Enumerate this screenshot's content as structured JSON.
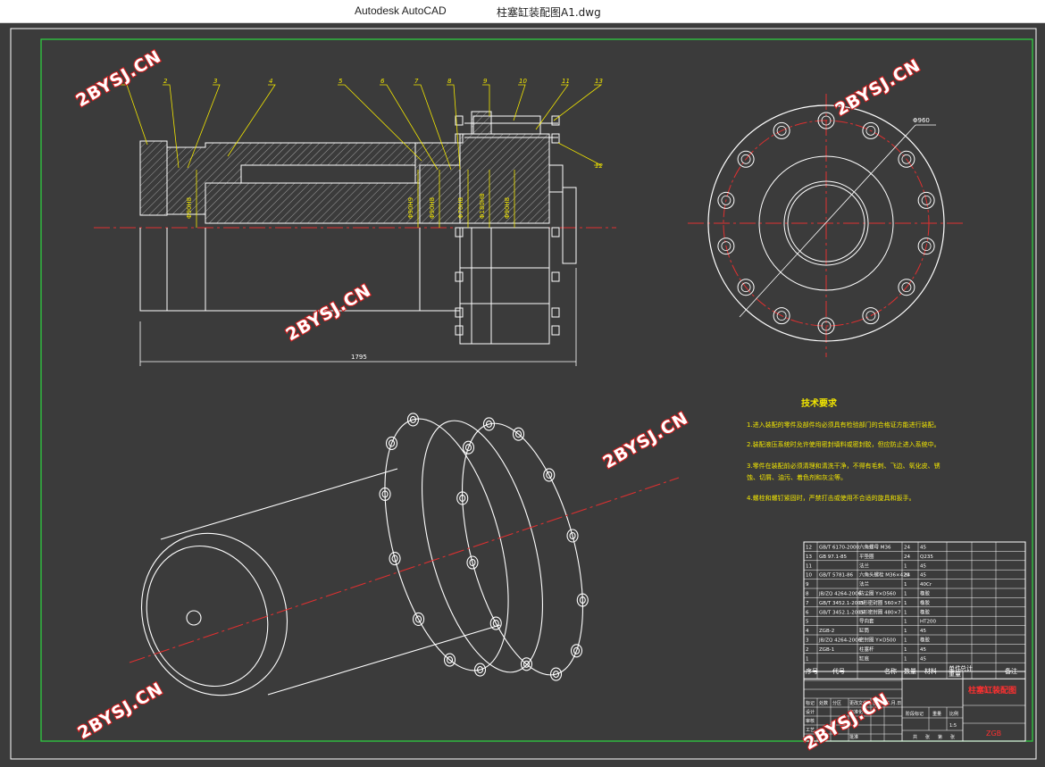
{
  "window": {
    "app_name": "Autodesk AutoCAD",
    "file_name": "柱塞缸装配图A1.dwg"
  },
  "drawing": {
    "watermark": "2BYSJ.CN",
    "part_numbers": [
      "1",
      "2",
      "3",
      "4",
      "5",
      "6",
      "7",
      "8",
      "9",
      "10",
      "11",
      "13",
      "12"
    ],
    "dimensions": {
      "overall_length": "1795",
      "flange_diameter": "Φ960",
      "fits": [
        "Φ90H8",
        "Φ90H9",
        "Φ90H8",
        "Φ70H8",
        "Φ180H8",
        "Φ90H8"
      ]
    },
    "technical_requirements": {
      "title": "技术要求",
      "items": [
        "1.进入装配的零件及部件均必须具有检验部门的合格证方能进行装配。",
        "2.装配液压系统时允许使用密封填料或密封胶，但应防止进入系统中。",
        "3.零件在装配前必须清理和清洗干净，不得有毛刺、飞边、氧化皮、锈",
        "蚀、切屑、油污、着色剂和灰尘等。",
        "4.螺栓和螺钉紧固时，严禁打击或使用不合适的旋具和扳手。"
      ]
    },
    "bom": {
      "headers": [
        "序号",
        "代号",
        "名称",
        "数量",
        "材料",
        "单件",
        "总计",
        "重量",
        "备注"
      ],
      "rows": [
        [
          "12",
          "GB/T 6170-2000",
          "六角螺母 M36",
          "24",
          "45"
        ],
        [
          "13",
          "GB 97.1-85",
          "平垫圈",
          "24",
          "Q235"
        ],
        [
          "11",
          "",
          "法兰",
          "1",
          "45"
        ],
        [
          "10",
          "GB/T 5781-86",
          "六角头螺栓 M36×420",
          "24",
          "45"
        ],
        [
          "9",
          "",
          "法兰",
          "1",
          "40Cr"
        ],
        [
          "8",
          "JB/ZQ 4264-2006",
          "防尘圈 Y×D560",
          "1",
          "橡胶"
        ],
        [
          "7",
          "GB/T 3452.1-2005",
          "O形密封圈 560×7",
          "1",
          "橡胶"
        ],
        [
          "6",
          "GB/T 3452.1-2005",
          "O形密封圈 480×7",
          "1",
          "橡胶"
        ],
        [
          "5",
          "",
          "导向套",
          "1",
          "HT200"
        ],
        [
          "4",
          "ZGB-2",
          "缸筒",
          "1",
          "45"
        ],
        [
          "3",
          "JB/ZQ 4264-2006",
          "密封圈 Y×D500",
          "1",
          "橡胶"
        ],
        [
          "2",
          "ZGB-1",
          "柱塞杆",
          "1",
          "45"
        ],
        [
          "1",
          "",
          "缸底",
          "1",
          "45"
        ]
      ]
    },
    "title_block": {
      "drawing_name": "柱塞缸装配图",
      "drawing_no": "ZGB",
      "labels": [
        "标记",
        "处数",
        "分区",
        "更改文件号",
        "签名",
        "年.月.日",
        "设计",
        "标准化",
        "审核",
        "工艺",
        "批准",
        "阶段标记",
        "重量",
        "比例",
        "共",
        "张",
        "第",
        "张"
      ],
      "scale": "1:5"
    }
  }
}
